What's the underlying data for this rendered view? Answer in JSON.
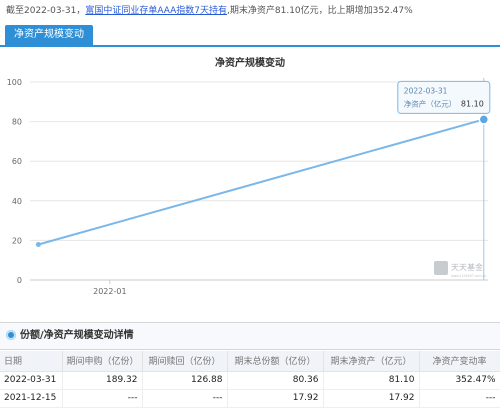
{
  "header": {
    "text_before_link": "截至2022-03-31，",
    "link_text": "富国中证同业存单AAA指数7天持有",
    "text_after_link": ",期末净资产81.10亿元，比上期增加352.47%"
  },
  "tabs": [
    {
      "label": "净资产规模变动",
      "active": true
    }
  ],
  "chart_data": {
    "type": "line",
    "title": "净资产规模变动",
    "xlabel": "",
    "ylabel": "",
    "x": [
      "2021-12-15",
      "2022-03-31"
    ],
    "series": [
      {
        "name": "净资产（亿元）",
        "values": [
          17.92,
          81.1
        ]
      }
    ],
    "xtick_labels": [
      "2022-01"
    ],
    "ytick_labels": [
      "0",
      "20",
      "40",
      "60",
      "80",
      "100"
    ],
    "ylim": [
      0,
      100
    ],
    "grid": true,
    "color": "#7bb7e8",
    "tooltip": {
      "date": "2022-03-31",
      "label": "净资产（亿元）",
      "value": "81.10"
    }
  },
  "watermark": {
    "main": "天天基金",
    "sub": "www.1234567.com.cn"
  },
  "detail": {
    "title": "份额/净资产规模变动详情",
    "columns": [
      "日期",
      "期间申购（亿份）",
      "期间赎回（亿份）",
      "期末总份额（亿份）",
      "期末净资产（亿元）",
      "净资产变动率"
    ],
    "rows": [
      [
        "2022-03-31",
        "189.32",
        "126.88",
        "80.36",
        "81.10",
        "352.47%"
      ],
      [
        "2021-12-15",
        "---",
        "---",
        "17.92",
        "17.92",
        "---"
      ]
    ]
  }
}
